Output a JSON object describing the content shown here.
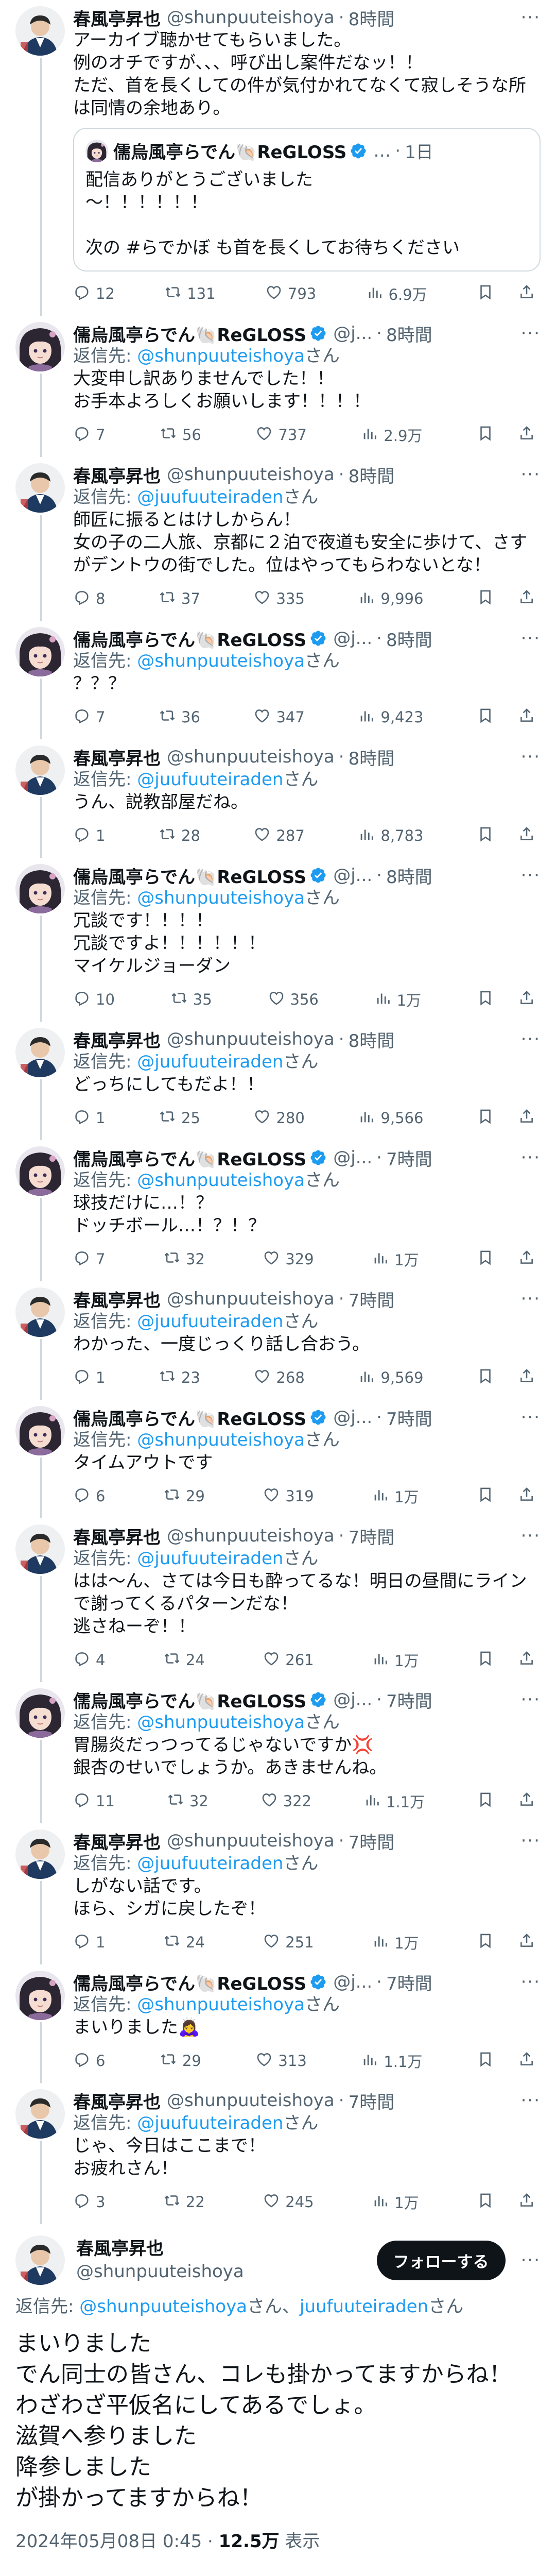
{
  "colors": {
    "link": "#1d9bf0",
    "verified": "#1d9bf0",
    "muted": "#536471",
    "text": "#0f1419",
    "line": "#cfd9de"
  },
  "labels": {
    "reply_prefix": "返信先: ",
    "reply_suffix": "さん",
    "reply_joiner": "さん、",
    "views_suffix": " 表示"
  },
  "tweets": [
    {
      "author": "shunpu",
      "name": "春風亭昇也",
      "handle": "@shunpuuteishoya",
      "verified": false,
      "time": "8時間",
      "reply_to": [],
      "text": "アーカイブ聴かせてもらいました。\n例のオチですが、、、呼び出し案件だなッ！！\nただ、首を長くしての件が気付かれてなくて寂しそうな所は同情の余地あり。",
      "quote": {
        "name": "儒烏風亭らでん🐚ReGLOSS",
        "handle": "…",
        "time": "1日",
        "text": "配信ありがとうございました\n〜！！！！！！\n\n次の #らでかぼ も首を長くしてお待ちください"
      },
      "stats": {
        "replies": "12",
        "reposts": "131",
        "likes": "793",
        "views": "6.9万"
      }
    },
    {
      "author": "raden",
      "name": "儒烏風亭らでん🐚ReGLOSS",
      "handle": "@j...",
      "verified": true,
      "time": "8時間",
      "reply_to": [
        "shunpuuteishoya"
      ],
      "text": "大変申し訳ありませんでした！！\nお手本よろしくお願いします！！！！",
      "quote": null,
      "stats": {
        "replies": "7",
        "reposts": "56",
        "likes": "737",
        "views": "2.9万"
      }
    },
    {
      "author": "shunpu",
      "name": "春風亭昇也",
      "handle": "@shunpuuteishoya",
      "verified": false,
      "time": "8時間",
      "reply_to": [
        "juufuuteiraden"
      ],
      "text": "師匠に振るとはけしからん！\n女の子の二人旅、京都に２泊で夜道も安全に歩けて、さすがデントウの街でした。位はやってもらわないとな！",
      "quote": null,
      "stats": {
        "replies": "8",
        "reposts": "37",
        "likes": "335",
        "views": "9,996"
      }
    },
    {
      "author": "raden",
      "name": "儒烏風亭らでん🐚ReGLOSS",
      "handle": "@j...",
      "verified": true,
      "time": "8時間",
      "reply_to": [
        "shunpuuteishoya"
      ],
      "text": "？？？",
      "quote": null,
      "stats": {
        "replies": "7",
        "reposts": "36",
        "likes": "347",
        "views": "9,423"
      }
    },
    {
      "author": "shunpu",
      "name": "春風亭昇也",
      "handle": "@shunpuuteishoya",
      "verified": false,
      "time": "8時間",
      "reply_to": [
        "juufuuteiraden"
      ],
      "text": "うん、説教部屋だね。",
      "quote": null,
      "stats": {
        "replies": "1",
        "reposts": "28",
        "likes": "287",
        "views": "8,783"
      }
    },
    {
      "author": "raden",
      "name": "儒烏風亭らでん🐚ReGLOSS",
      "handle": "@j...",
      "verified": true,
      "time": "8時間",
      "reply_to": [
        "shunpuuteishoya"
      ],
      "text": "冗談です！！！！\n冗談ですよ！！！！！！\nマイケルジョーダン",
      "quote": null,
      "stats": {
        "replies": "10",
        "reposts": "35",
        "likes": "356",
        "views": "1万"
      }
    },
    {
      "author": "shunpu",
      "name": "春風亭昇也",
      "handle": "@shunpuuteishoya",
      "verified": false,
      "time": "8時間",
      "reply_to": [
        "juufuuteiraden"
      ],
      "text": "どっちにしてもだよ！！",
      "quote": null,
      "stats": {
        "replies": "1",
        "reposts": "25",
        "likes": "280",
        "views": "9,566"
      }
    },
    {
      "author": "raden",
      "name": "儒烏風亭らでん🐚ReGLOSS",
      "handle": "@j...",
      "verified": true,
      "time": "7時間",
      "reply_to": [
        "shunpuuteishoya"
      ],
      "text": "球技だけに…！？\nドッチボール…！？！？",
      "quote": null,
      "stats": {
        "replies": "7",
        "reposts": "32",
        "likes": "329",
        "views": "1万"
      }
    },
    {
      "author": "shunpu",
      "name": "春風亭昇也",
      "handle": "@shunpuuteishoya",
      "verified": false,
      "time": "7時間",
      "reply_to": [
        "juufuuteiraden"
      ],
      "text": "わかった、一度じっくり話し合おう。",
      "quote": null,
      "stats": {
        "replies": "1",
        "reposts": "23",
        "likes": "268",
        "views": "9,569"
      }
    },
    {
      "author": "raden",
      "name": "儒烏風亭らでん🐚ReGLOSS",
      "handle": "@j...",
      "verified": true,
      "time": "7時間",
      "reply_to": [
        "shunpuuteishoya"
      ],
      "text": "タイムアウトです",
      "quote": null,
      "stats": {
        "replies": "6",
        "reposts": "29",
        "likes": "319",
        "views": "1万"
      }
    },
    {
      "author": "shunpu",
      "name": "春風亭昇也",
      "handle": "@shunpuuteishoya",
      "verified": false,
      "time": "7時間",
      "reply_to": [
        "juufuuteiraden"
      ],
      "text": "はは〜ん、さては今日も酔ってるな！明日の昼間にラインで謝ってくるパターンだな！\n逃さねーぞ！！",
      "quote": null,
      "stats": {
        "replies": "4",
        "reposts": "24",
        "likes": "261",
        "views": "1万"
      }
    },
    {
      "author": "raden",
      "name": "儒烏風亭らでん🐚ReGLOSS",
      "handle": "@j...",
      "verified": true,
      "time": "7時間",
      "reply_to": [
        "shunpuuteishoya"
      ],
      "text": "胃腸炎だっつってるじゃないですか💢\n銀杏のせいでしょうか。あきませんね。",
      "quote": null,
      "stats": {
        "replies": "11",
        "reposts": "32",
        "likes": "322",
        "views": "1.1万"
      }
    },
    {
      "author": "shunpu",
      "name": "春風亭昇也",
      "handle": "@shunpuuteishoya",
      "verified": false,
      "time": "7時間",
      "reply_to": [
        "juufuuteiraden"
      ],
      "text": "しがない話です。\nほら、シガに戻したぞ！",
      "quote": null,
      "stats": {
        "replies": "1",
        "reposts": "24",
        "likes": "251",
        "views": "1万"
      }
    },
    {
      "author": "raden",
      "name": "儒烏風亭らでん🐚ReGLOSS",
      "handle": "@j...",
      "verified": true,
      "time": "7時間",
      "reply_to": [
        "shunpuuteishoya"
      ],
      "text": "まいりました🙇‍♀️",
      "quote": null,
      "stats": {
        "replies": "6",
        "reposts": "29",
        "likes": "313",
        "views": "1.1万"
      }
    },
    {
      "author": "shunpu",
      "name": "春風亭昇也",
      "handle": "@shunpuuteishoya",
      "verified": false,
      "time": "7時間",
      "reply_to": [
        "juufuuteiraden"
      ],
      "text": "じゃ、今日はここまで！\nお疲れさん！",
      "quote": null,
      "stats": {
        "replies": "3",
        "reposts": "22",
        "likes": "245",
        "views": "1万"
      }
    }
  ],
  "focal": {
    "name": "春風亭昇也",
    "handle": "@shunpuuteishoya",
    "follow_label": "フォローする",
    "reply_to": [
      "shunpuuteishoya",
      "juufuuteiraden"
    ],
    "text": "まいりました\nでん同士の皆さん、コレも掛かってますからね！\nわざわざ平仮名にしてあるでしょ。\n滋賀へ参りました\n降参しました\nが掛かってますからね！",
    "timestamp": "2024年05月08日 0:45",
    "views": "12.5万"
  }
}
